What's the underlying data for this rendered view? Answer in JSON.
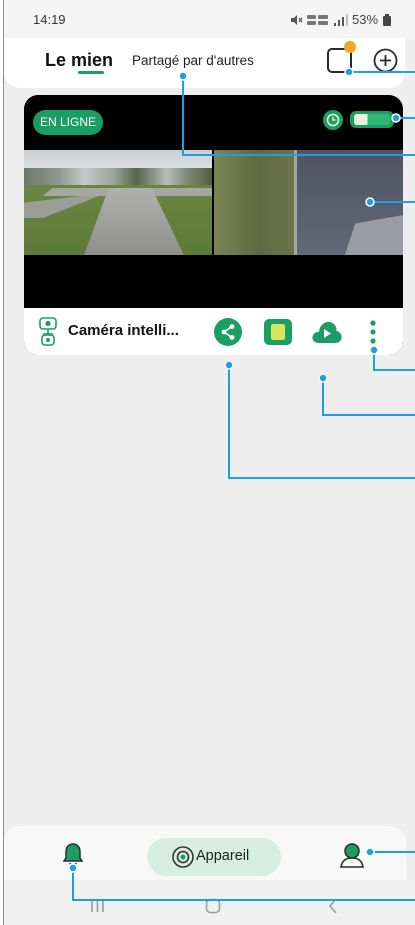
{
  "status_bar": {
    "time": "14:19",
    "battery_text": "53%",
    "icons": [
      "mute-icon",
      "volte-4g-icon",
      "signal-icon",
      "battery-icon"
    ]
  },
  "header": {
    "tabs": [
      {
        "label": "Le mien",
        "active": true
      },
      {
        "label": "Partagé par d'autres",
        "active": false
      }
    ],
    "actions": [
      "message-icon",
      "add-circle-icon"
    ]
  },
  "device_card": {
    "status_badge": "EN LIGNE",
    "name": "Caméra intelli...",
    "device_icon": "security-camera-icon",
    "status_icons": [
      "clock-icon",
      "battery-icon"
    ],
    "actions": [
      "share-icon",
      "sd-card-icon",
      "cloud-playback-icon",
      "more-vertical-icon"
    ]
  },
  "bottom_nav": {
    "items": [
      {
        "icon": "bell-icon"
      },
      {
        "icon": "camera-lens-icon",
        "label": "Appareil",
        "active": true
      },
      {
        "icon": "user-icon"
      }
    ]
  },
  "system_nav": [
    "recents-icon",
    "home-icon",
    "back-icon"
  ],
  "colors": {
    "accent": "#1a9e63",
    "badge_text": "#ffffff",
    "notification_dot": "#f5a623",
    "active_nav_pill": "#d5eee1",
    "callout": "#1ea0e0",
    "background": "#eeeeee"
  }
}
